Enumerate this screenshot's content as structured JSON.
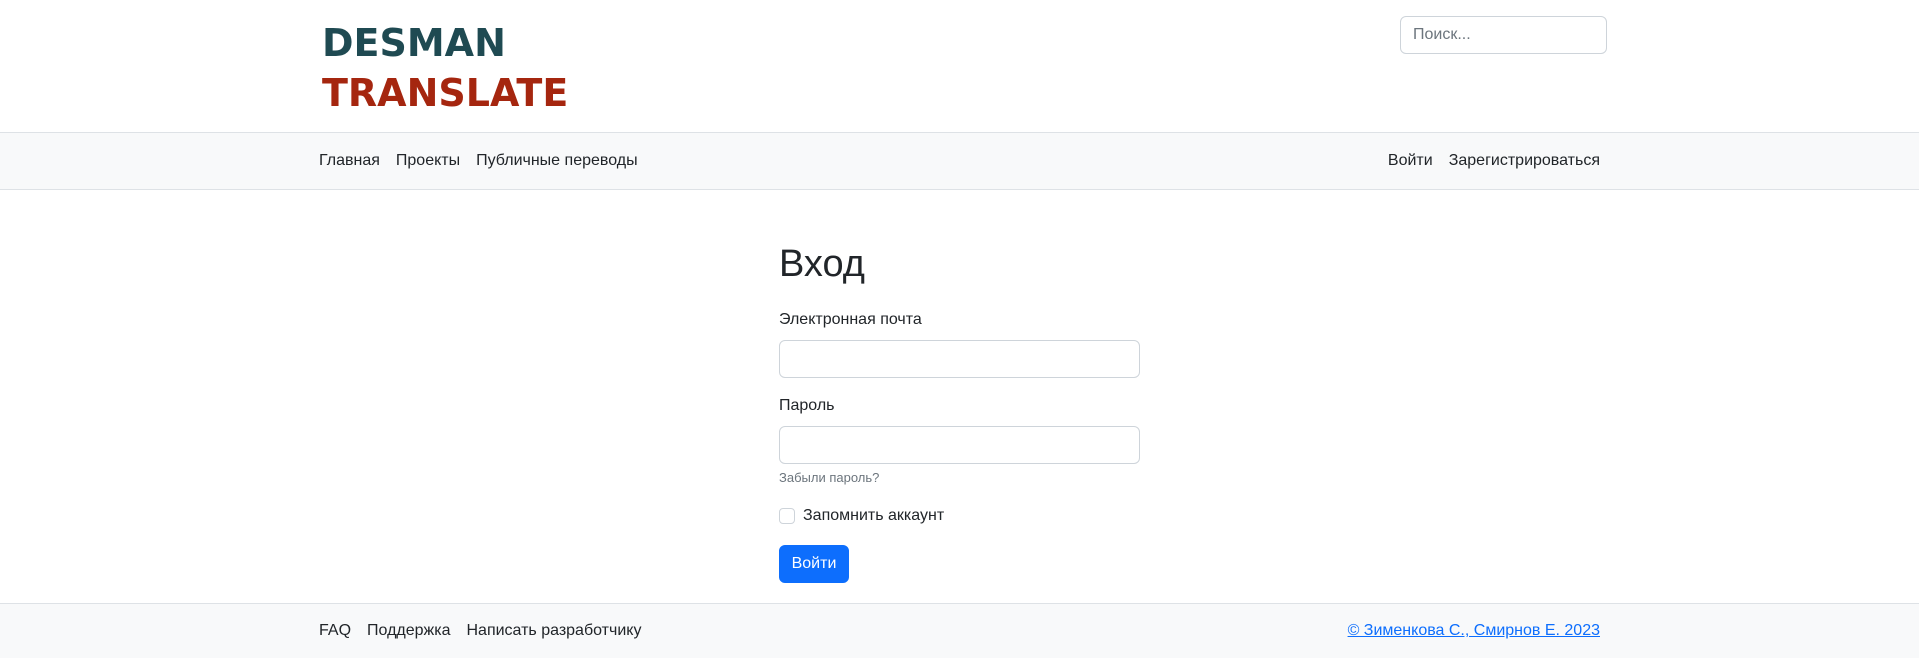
{
  "header": {
    "logo_line1": "DESMAN",
    "logo_line2": "TRANSLATE",
    "search_placeholder": "Поиск..."
  },
  "navbar": {
    "left": [
      "Главная",
      "Проекты",
      "Публичные переводы"
    ],
    "right": [
      "Войти",
      "Зарегистрироваться"
    ]
  },
  "form": {
    "title": "Вход",
    "email_label": "Электронная почта",
    "email_value": "",
    "password_label": "Пароль",
    "password_value": "",
    "forgot_password": "Забыли пароль?",
    "remember_label": "Запомнить аккаунт",
    "remember_checked": false,
    "submit_label": "Войти"
  },
  "footer": {
    "links": [
      "FAQ",
      "Поддержка",
      "Написать разработчику"
    ],
    "copyright": "© Зименкова С., Смирнов Е. 2023"
  },
  "colors": {
    "logo_dark": "#1f4a52",
    "logo_red": "#a5260f",
    "primary": "#0d6efd",
    "bar_bg": "#f8f9fa"
  }
}
